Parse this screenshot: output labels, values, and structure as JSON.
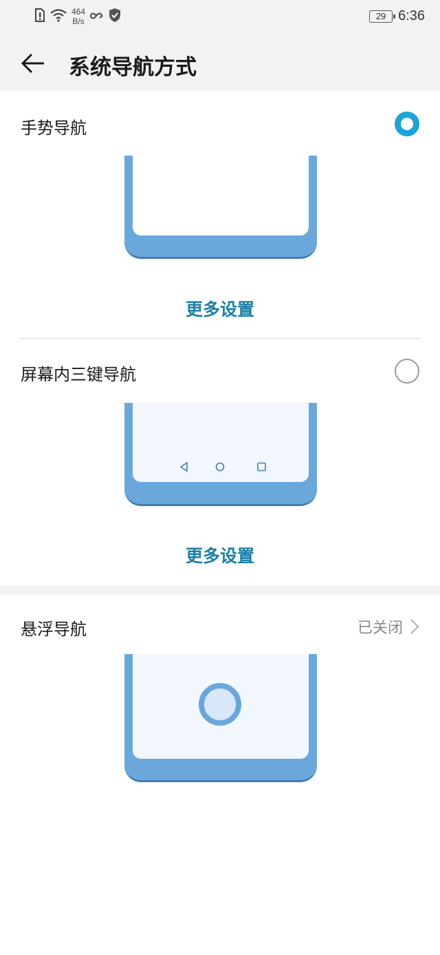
{
  "status_bar": {
    "net_speed_value": "464",
    "net_speed_unit": "B/s",
    "battery": "29",
    "time": "6:36"
  },
  "header": {
    "title": "系统导航方式"
  },
  "options": [
    {
      "label": "手势导航",
      "selected": true,
      "more": "更多设置"
    },
    {
      "label": "屏幕内三键导航",
      "selected": false,
      "more": "更多设置"
    }
  ],
  "floating": {
    "label": "悬浮导航",
    "status": "已关闭"
  },
  "colors": {
    "accent": "#1aa4d8",
    "link": "#1b7fa8",
    "phone_frame": "#6aa8dc",
    "background_gray": "#f2f2f2"
  },
  "icons": [
    "sim-alert-icon",
    "wifi-icon",
    "link-icon",
    "shield-icon",
    "back-arrow-icon",
    "chevron-right-icon",
    "nav-back-icon",
    "nav-home-icon",
    "nav-recents-icon"
  ]
}
